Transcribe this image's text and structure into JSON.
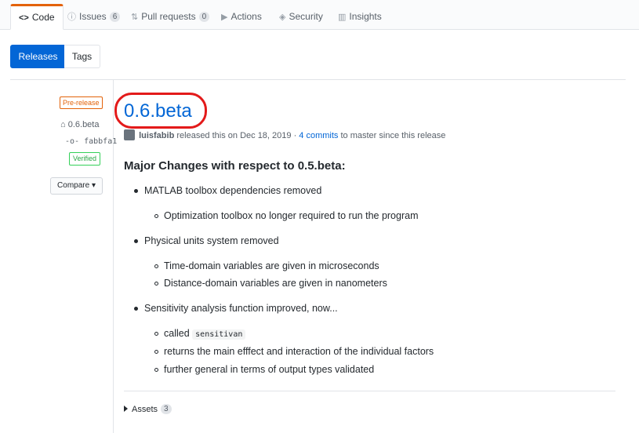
{
  "tabs": [
    {
      "icon": "code-icon",
      "glyph": "<>",
      "label": "Code",
      "active": true
    },
    {
      "icon": "issue-icon",
      "glyph": "ⓘ",
      "label": "Issues",
      "count": "6"
    },
    {
      "icon": "pull-request-icon",
      "glyph": "⇅",
      "label": "Pull requests",
      "count": "0"
    },
    {
      "icon": "play-icon",
      "glyph": "▶",
      "label": "Actions"
    },
    {
      "icon": "shield-icon",
      "glyph": "◈",
      "label": "Security"
    },
    {
      "icon": "graph-icon",
      "glyph": "▥",
      "label": "Insights"
    }
  ],
  "subnav": {
    "releases": "Releases",
    "tags": "Tags"
  },
  "sidebar": {
    "badge": "Pre-release",
    "tag": "0.6.beta",
    "commit": "fabbfa1",
    "verified": "Verified",
    "compare": "Compare ▾"
  },
  "release": {
    "title": "0.6.beta",
    "author": "luisfabib",
    "released_text": "released this on Dec 18, 2019 ·",
    "commits_link": "4 commits",
    "since_text": "to master since this release",
    "heading": "Major Changes with respect to 0.5.beta:",
    "items": [
      {
        "text": "MATLAB toolbox dependencies removed",
        "sub": [
          "Optimization toolbox no longer required to run the program"
        ]
      },
      {
        "text": "Physical units system removed",
        "sub": [
          "Time-domain variables are given in microseconds",
          "Distance-domain variables are given in nanometers"
        ]
      },
      {
        "text": "Sensitivity analysis function improved, now...",
        "sub": [
          "called",
          "returns the main efffect and interaction of the individual factors",
          "further general in terms of output types validated"
        ]
      }
    ],
    "code_word": "sensitivan"
  },
  "assets": {
    "label": "Assets",
    "count": "3"
  }
}
